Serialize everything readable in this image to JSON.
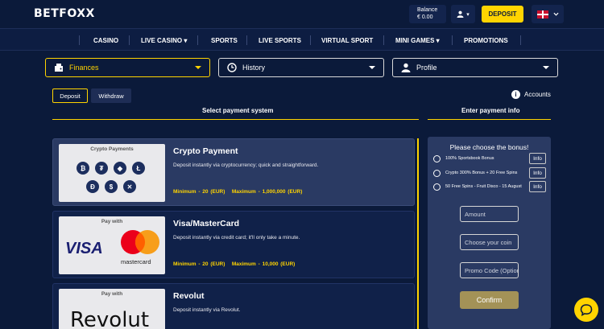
{
  "header": {
    "brand": "BETFOXX",
    "balance_label": "Balance",
    "balance_value": "€ 0.00",
    "deposit_label": "DEPOSIT",
    "accent": "#ffd400"
  },
  "nav": {
    "items": [
      {
        "label": "CASINO"
      },
      {
        "label": "LIVE CASINO ▾"
      },
      {
        "label": "SPORTS"
      },
      {
        "label": "LIVE SPORTS"
      },
      {
        "label": "VIRTUAL SPORT"
      },
      {
        "label": "MINI GAMES ▾"
      },
      {
        "label": "PROMOTIONS"
      }
    ]
  },
  "menus": {
    "finances": "Finances",
    "history": "History",
    "profile": "Profile"
  },
  "tabs": {
    "deposit": "Deposit",
    "withdraw": "Withdraw",
    "accounts": "Accounts"
  },
  "sections": {
    "select_payment": "Select payment system",
    "enter_payment_info": "Enter payment info"
  },
  "payments": [
    {
      "logo_caption": "Crypto Payments",
      "title": "Crypto Payment",
      "description": "Deposit instantly via cryptocurrency; quick and straightforward.",
      "min": "Minimum - 20 (EUR)",
      "max": "Maximum - 1,000,000 (EUR)"
    },
    {
      "logo_caption": "Pay with",
      "title": "Visa/MasterCard",
      "description": "Deposit instantly via credit card; it'll only take a minute.",
      "min": "Minimum - 20 (EUR)",
      "max": "Maximum - 10,000 (EUR)",
      "visa_text": "VISA",
      "mastercard_text": "mastercard"
    },
    {
      "logo_caption": "Pay with",
      "title": "Revolut",
      "description": "Deposit instantly via Revolut.",
      "logo_text": "Revolut"
    }
  ],
  "bonus_panel": {
    "title": "Please choose the bonus!",
    "bonuses": [
      {
        "label": "100% Sportsbook Bonus",
        "info": "Info"
      },
      {
        "label": "Crypto 300% Bonus + 20 Free Spins",
        "info": "Info"
      },
      {
        "label": "50 Free Spins - Fruit Disco - 15 August",
        "info": "Info"
      }
    ],
    "amount_placeholder": "Amount",
    "coin_placeholder": "Choose your coin",
    "promo_placeholder": "Promo Code (Optional)",
    "confirm_label": "Confirm"
  }
}
